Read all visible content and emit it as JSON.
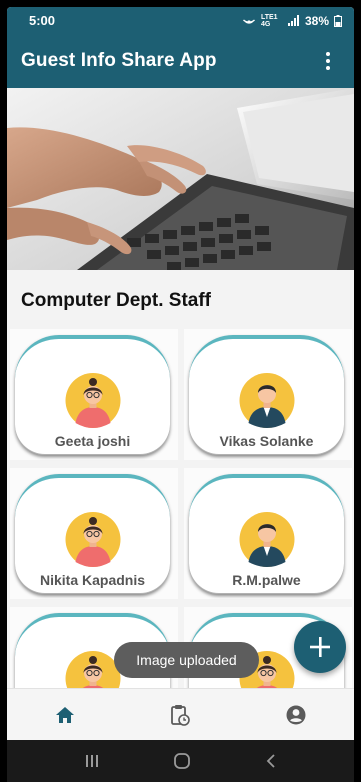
{
  "status": {
    "time": "5:00",
    "battery": "38%",
    "network": "LTE1 4G"
  },
  "appbar": {
    "title": "Guest Info Share App"
  },
  "section": {
    "title": "Computer Dept. Staff"
  },
  "staff": [
    {
      "name": "Geeta joshi",
      "avatar": "female-avatar"
    },
    {
      "name": "Vikas Solanke",
      "avatar": "male-avatar"
    },
    {
      "name": "Nikita Kapadnis",
      "avatar": "female-avatar"
    },
    {
      "name": "R.M.palwe",
      "avatar": "male-avatar"
    },
    {
      "name": "",
      "avatar": "female-avatar"
    },
    {
      "name": "",
      "avatar": "female-avatar"
    }
  ],
  "toast": {
    "message": "Image uploaded"
  },
  "fab": {
    "icon": "plus-icon"
  },
  "bottom_nav": [
    "home-icon",
    "clipboard-clock-icon",
    "account-icon"
  ],
  "colors": {
    "primary": "#1d5f73",
    "card_accent": "#5bb6bf",
    "avatar_bg": "#f5c23e"
  }
}
